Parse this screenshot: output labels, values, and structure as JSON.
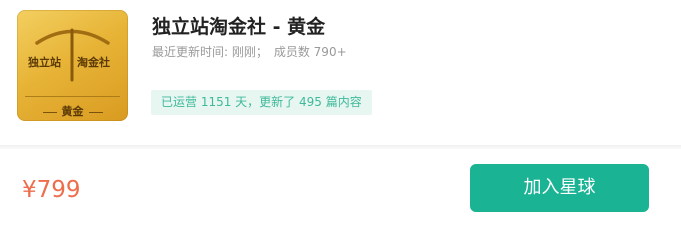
{
  "logo": {
    "left_text": "独立站",
    "right_text": "淘金社",
    "bottom_text": "黄金",
    "icon": "pickaxe-icon",
    "gradient_start": "#f3cf60",
    "gradient_end": "#d99b21"
  },
  "group": {
    "title": "独立站淘金社 - 黄金",
    "updated_label": "最近更新时间: 刚刚；",
    "members_label": "成员数 790+",
    "tag_text": "已运营 1151 天，更新了 495 篇内容"
  },
  "purchase": {
    "price": "¥799",
    "join_label": "加入星球"
  },
  "colors": {
    "accent": "#1ab394",
    "price": "#ee6d4c",
    "tag_bg": "#e8f6f1",
    "tag_text": "#3fb99a"
  }
}
